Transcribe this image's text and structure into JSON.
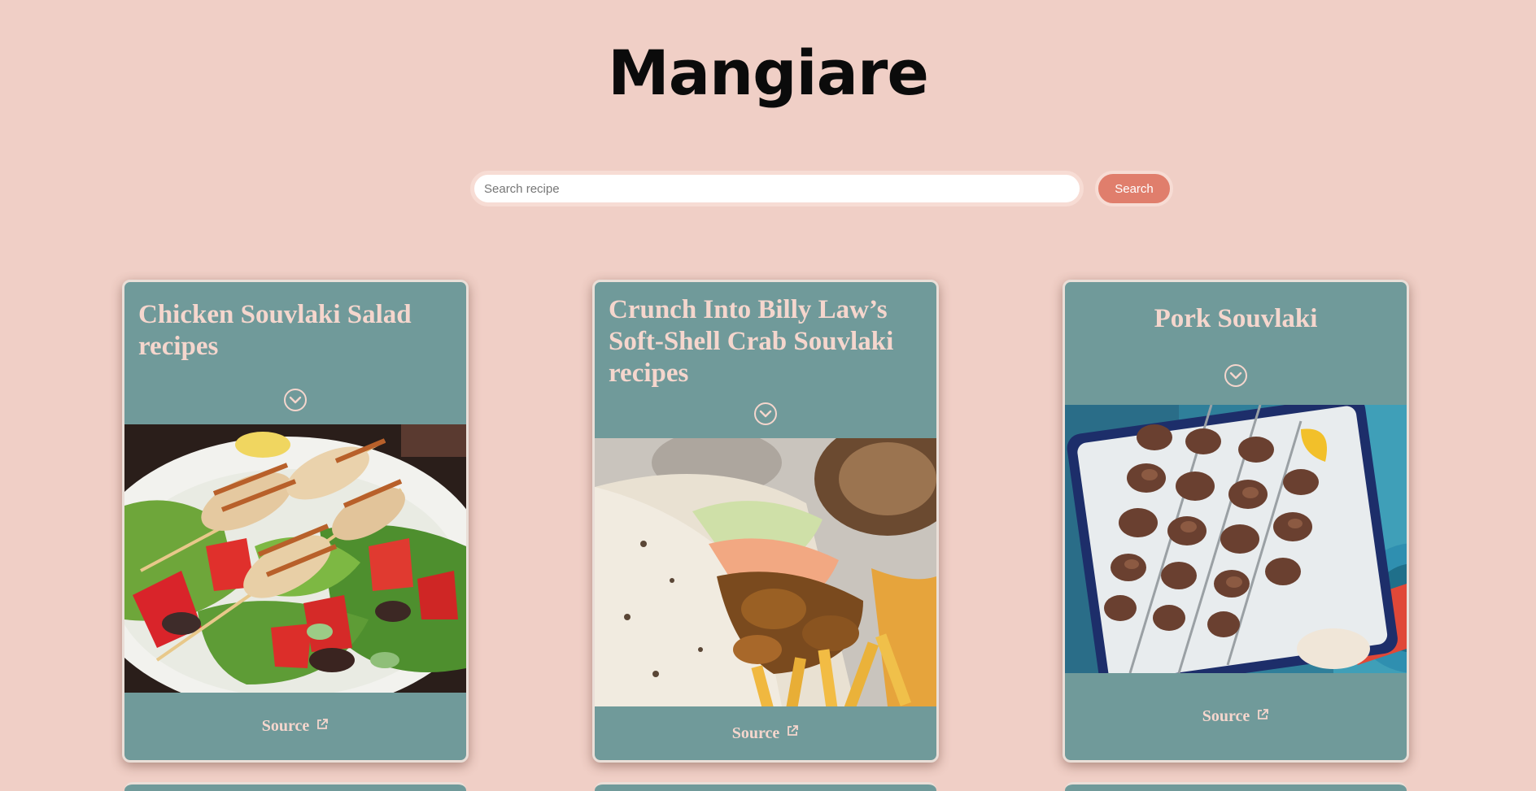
{
  "app": {
    "logo": "Mangiare"
  },
  "search": {
    "placeholder": "Search recipe",
    "value": "",
    "button_label": "Search"
  },
  "colors": {
    "background": "#f0cfc6",
    "card": "#709a9a",
    "card_text": "#f5d6cd",
    "button": "#e07e6c"
  },
  "recipes": [
    {
      "title": "Chicken Souvlaki Salad recipes",
      "source_label": "Source",
      "image": "grilled-chicken-skewer-salad"
    },
    {
      "title": "Crunch Into Billy Law’s Soft-Shell Crab Souvlaki recipes",
      "source_label": "Source",
      "image": "soft-shell-crab-souvlaki-wrap"
    },
    {
      "title": "Pork Souvlaki",
      "source_label": "Source",
      "image": "pork-skewers-on-tray"
    }
  ],
  "icons": {
    "expand": "chevron-down-circle-icon",
    "external": "external-link-icon"
  }
}
